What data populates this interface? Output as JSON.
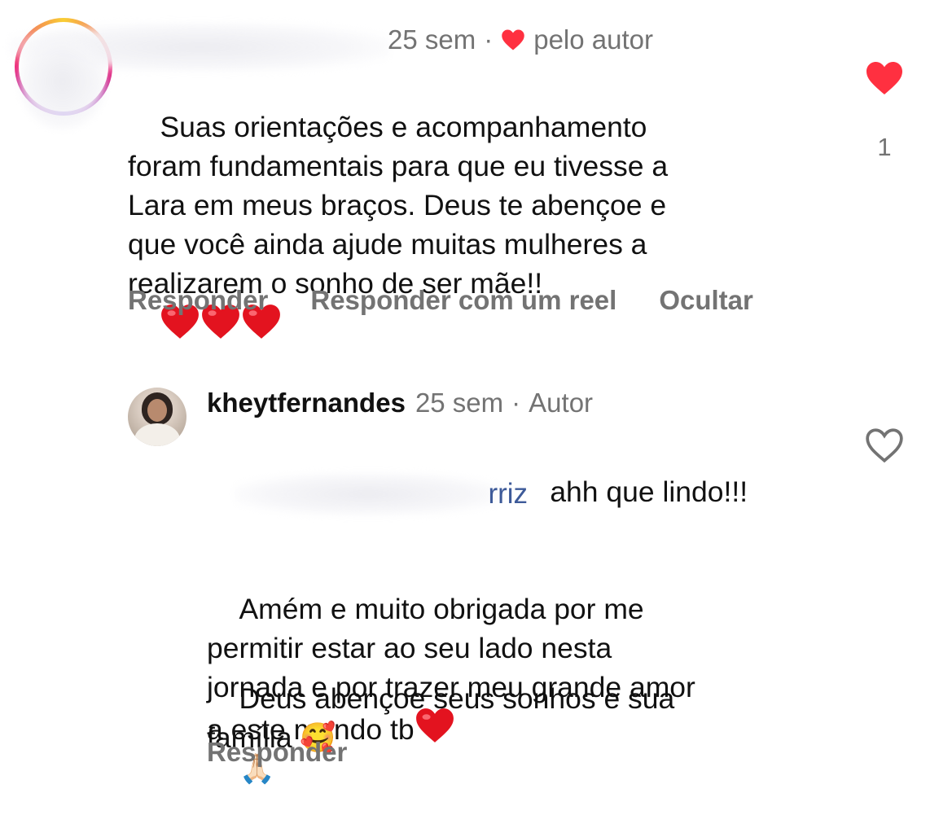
{
  "comment": {
    "username": "",
    "time": "25 sem",
    "liked_by_author_label": "pelo autor",
    "text": "Suas orientações e acompanhamento\nforam fundamentais para que eu tivesse a\nLara em meus braços. Deus te abençoe e\nque você ainda ajude muitas mulheres a\nrealizarem o sonho de ser mãe!!",
    "text_emojis": [
      "heart-icon",
      "heart-icon",
      "heart-icon"
    ],
    "like_count": "1",
    "liked": true,
    "actions": {
      "reply": "Responder",
      "reply_reel": "Responder com um reel",
      "hide": "Ocultar"
    }
  },
  "reply": {
    "username": "kheytfernandes",
    "time": "25 sem",
    "author_label": "Autor",
    "mention_tail": "rriz",
    "line1": " ahh que lindo!!!",
    "body": "Amém e muito obrigada por me\npermitir estar ao seu lado nesta\njornada e por trazer meu grande amor\na este mundo tb",
    "body_emoji": "🙏🏻",
    "second_para": "Deus abençoe seus sonhos e sua\nfamília ",
    "second_emoji": "🥰",
    "liked": false,
    "actions": {
      "reply": "Responder"
    }
  },
  "colors": {
    "heart_red": "#ff3040",
    "muted_text": "#737373",
    "mention_blue": "#3d5a99"
  }
}
